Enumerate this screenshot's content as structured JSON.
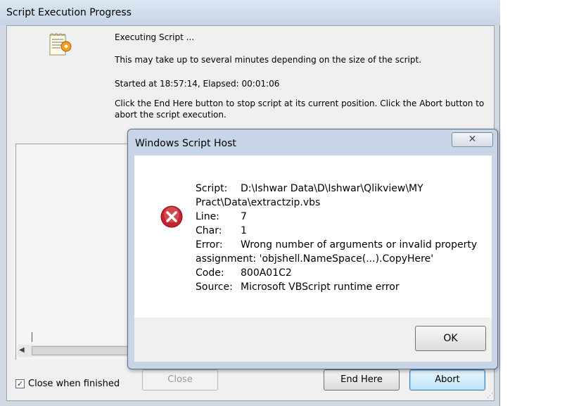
{
  "progress_window": {
    "title": "Script Execution Progress",
    "executing": "Executing Script ...",
    "info": "This may take up to several minutes depending on the size of the script.",
    "started": "Started at 18:57:14, Elapsed: 00:01:06",
    "instructions_line1": "Click the End Here button to stop script at its current position. Click the Abort button to",
    "instructions_line2": "abort the script execution.",
    "close_when_finished_label": "Close when finished",
    "close_when_finished_checked": true,
    "close_button": "Close",
    "end_here_button": "End Here",
    "abort_button": "Abort"
  },
  "dialog": {
    "title": "Windows Script Host",
    "close_glyph": "✕",
    "labels": {
      "script": "Script:",
      "line": "Line:",
      "char": "Char:",
      "error": "Error:",
      "code": "Code:",
      "source": "Source:"
    },
    "values": {
      "script": "D:\\Ishwar Data\\D\\Ishwar\\Qlikview\\MY",
      "script_cont": "Pract\\Data\\extractzip.vbs",
      "line": "7",
      "char": "1",
      "error": "Wrong number of arguments or invalid property",
      "error_cont": "assignment: 'objshell.NameSpace(...).CopyHere'",
      "code": "800A01C2",
      "source": "Microsoft VBScript runtime error"
    },
    "ok_button": "OK"
  },
  "icons": {
    "script_icon": "script-scroll-icon",
    "error_icon": "error-icon"
  },
  "colors": {
    "error_red": "#c8232c",
    "default_button_border": "#3c7fb1"
  }
}
